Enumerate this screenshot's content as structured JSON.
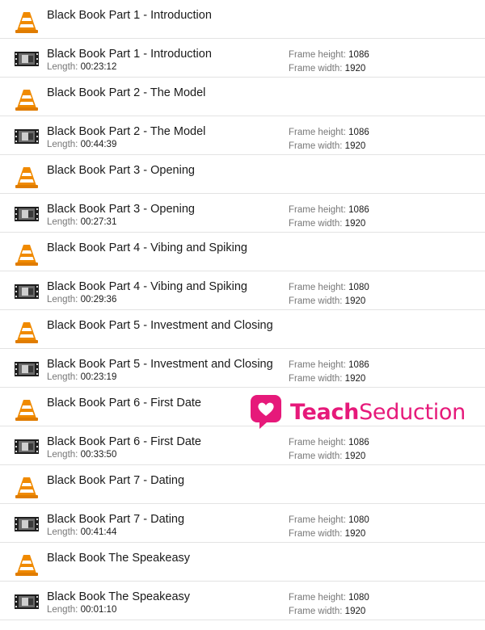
{
  "rows": [
    {
      "kind": "vlc",
      "title": "Black Book Part 1 - Introduction"
    },
    {
      "kind": "video",
      "title": "Black Book Part 1 - Introduction",
      "length": "00:23:12",
      "frame_height": "1086",
      "frame_width": "1920"
    },
    {
      "kind": "vlc",
      "title": "Black Book Part 2 - The Model"
    },
    {
      "kind": "video",
      "title": "Black Book Part 2 - The Model",
      "length": "00:44:39",
      "frame_height": "1086",
      "frame_width": "1920"
    },
    {
      "kind": "vlc",
      "title": "Black Book Part 3 - Opening"
    },
    {
      "kind": "video",
      "title": "Black Book Part 3 - Opening",
      "length": "00:27:31",
      "frame_height": "1086",
      "frame_width": "1920"
    },
    {
      "kind": "vlc",
      "title": "Black Book Part 4 - Vibing and Spiking"
    },
    {
      "kind": "video",
      "title": "Black Book Part 4 - Vibing and Spiking",
      "length": "00:29:36",
      "frame_height": "1080",
      "frame_width": "1920"
    },
    {
      "kind": "vlc",
      "title": "Black Book Part 5 - Investment and Closing"
    },
    {
      "kind": "video",
      "title": "Black Book Part 5 - Investment and Closing",
      "length": "00:23:19",
      "frame_height": "1086",
      "frame_width": "1920"
    },
    {
      "kind": "vlc",
      "title": "Black Book Part 6 - First Date"
    },
    {
      "kind": "video",
      "title": "Black Book Part 6 - First Date",
      "length": "00:33:50",
      "frame_height": "1086",
      "frame_width": "1920"
    },
    {
      "kind": "vlc",
      "title": "Black Book Part 7 - Dating"
    },
    {
      "kind": "video",
      "title": "Black Book Part 7 - Dating",
      "length": "00:41:44",
      "frame_height": "1080",
      "frame_width": "1920"
    },
    {
      "kind": "vlc",
      "title": "Black Book The Speakeasy"
    },
    {
      "kind": "video",
      "title": "Black Book The Speakeasy",
      "length": "00:01:10",
      "frame_height": "1080",
      "frame_width": "1920"
    }
  ],
  "labels": {
    "length": "Length:",
    "frame_height": "Frame height:",
    "frame_width": "Frame width:"
  },
  "watermark": {
    "bold": "Teach",
    "rest": "Seduction",
    "color": "#e6197a"
  },
  "colors": {
    "cone_orange": "#f08a00",
    "row_border": "#e3e3e3"
  },
  "icons": {
    "vlc": "vlc-cone-icon",
    "video": "video-thumbnail-icon"
  }
}
